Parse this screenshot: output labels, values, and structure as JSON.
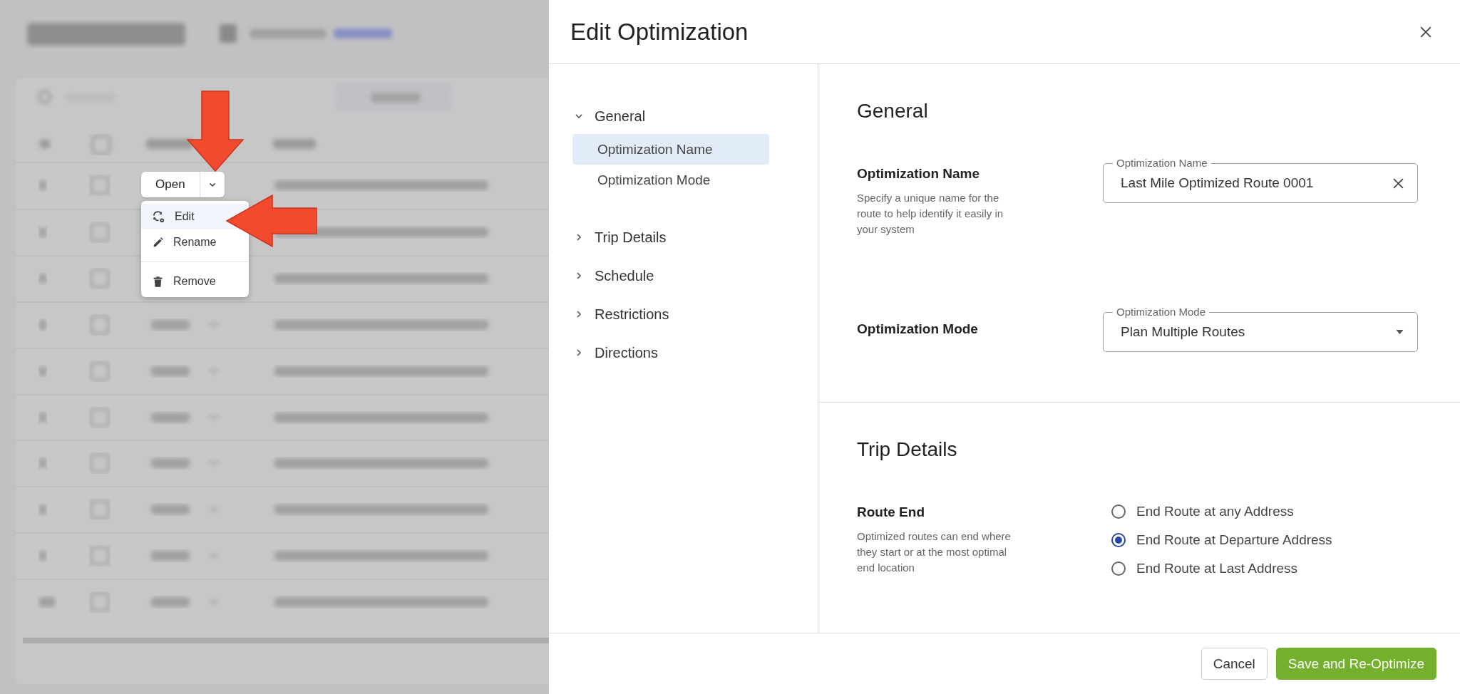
{
  "action_menu": {
    "button": "Open",
    "items": [
      {
        "kind": "edit",
        "label": "Edit",
        "selected": true
      },
      {
        "kind": "rename",
        "label": "Rename",
        "selected": false
      },
      {
        "kind": "remove",
        "label": "Remove",
        "selected": false
      }
    ]
  },
  "dialog": {
    "title": "Edit Optimization",
    "nav": [
      {
        "label": "General",
        "expanded": true,
        "children": [
          {
            "label": "Optimization Name",
            "selected": true
          },
          {
            "label": "Optimization Mode",
            "selected": false
          }
        ]
      },
      {
        "label": "Trip Details",
        "expanded": false
      },
      {
        "label": "Schedule",
        "expanded": false
      },
      {
        "label": "Restrictions",
        "expanded": false
      },
      {
        "label": "Directions",
        "expanded": false
      }
    ],
    "sections": [
      {
        "title": "General",
        "settings": [
          {
            "kind": "text",
            "label": "Optimization Name",
            "description": "Specify a unique name for the route to help identify it easily in your system",
            "field_label": "Optimization Name",
            "value": "Last Mile Optimized Route 0001"
          },
          {
            "kind": "select",
            "label": "Optimization Mode",
            "field_label": "Optimization Mode",
            "value": "Plan Multiple Routes"
          }
        ]
      },
      {
        "title": "Trip Details",
        "settings": [
          {
            "kind": "radio",
            "label": "Route End",
            "description": "Optimized routes can end where they start or at the most optimal end location",
            "options": [
              {
                "label": "End Route at any Address",
                "selected": false
              },
              {
                "label": "End Route at Departure Address",
                "selected": true
              },
              {
                "label": "End Route at Last Address",
                "selected": false
              }
            ]
          }
        ]
      }
    ],
    "buttons": [
      {
        "kind": "secondary",
        "label": "Cancel"
      },
      {
        "kind": "primary",
        "label": "Save and Re-Optimize"
      }
    ]
  }
}
